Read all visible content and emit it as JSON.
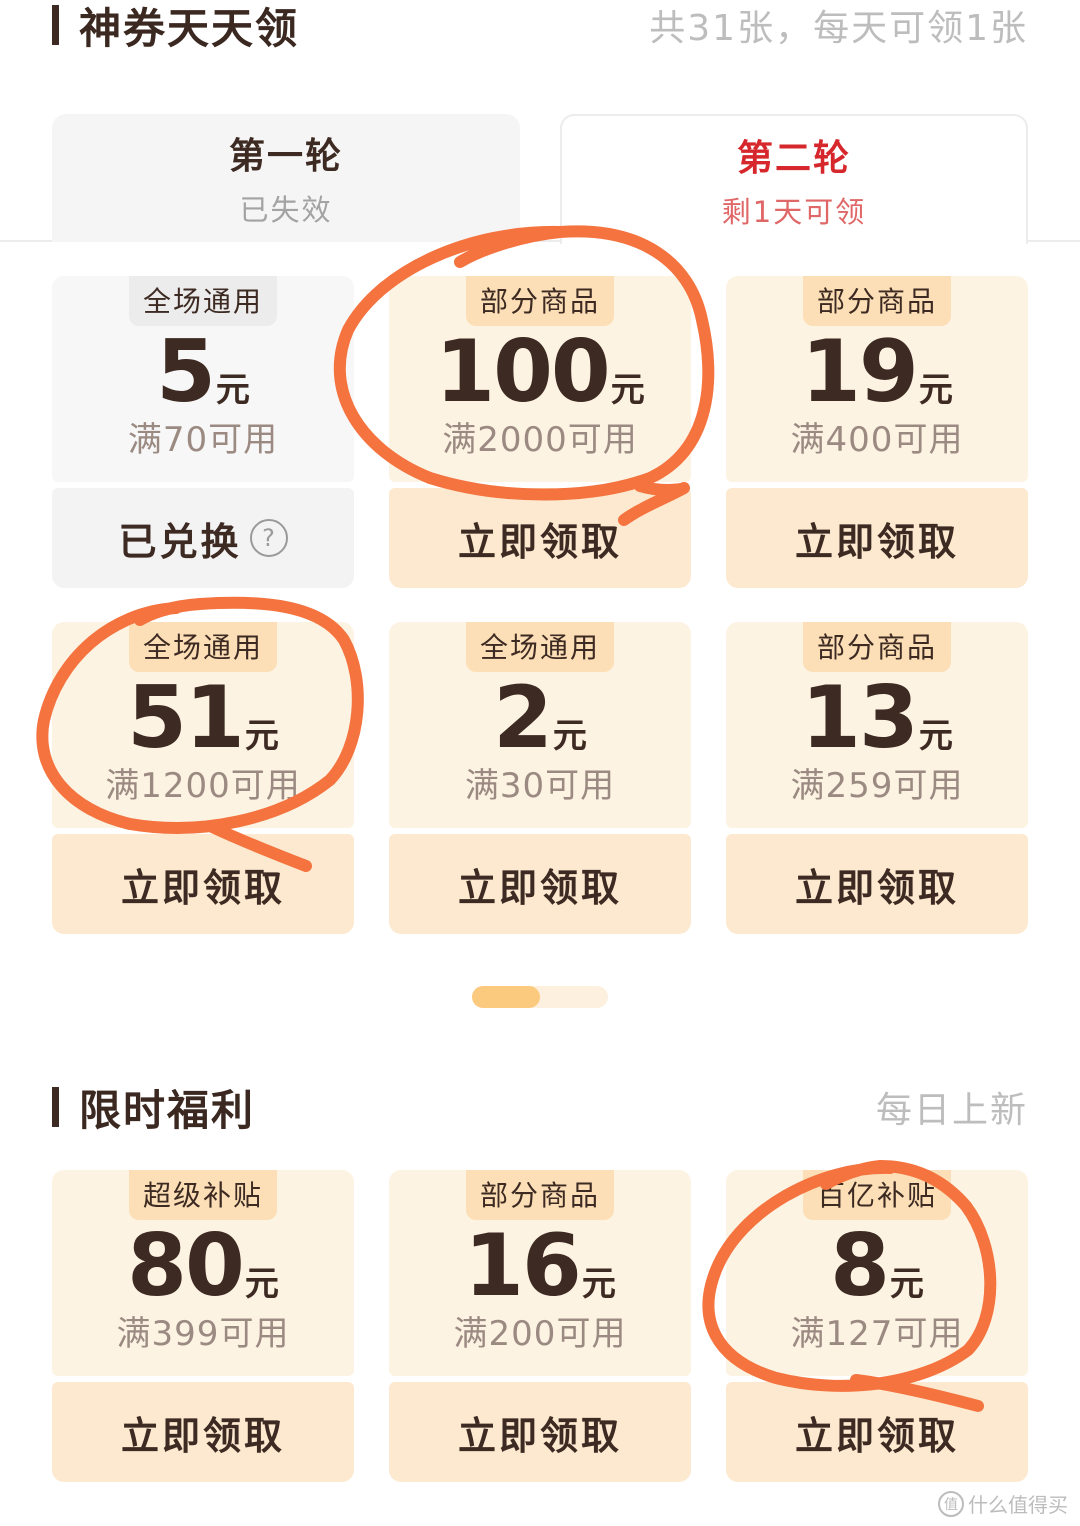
{
  "section1": {
    "title": "神券天天领",
    "subtitle": "共31张，每天可领1张"
  },
  "rounds": [
    {
      "name": "第一轮",
      "status": "已失效",
      "active": false
    },
    {
      "name": "第二轮",
      "status": "剩1天可领",
      "active": true
    }
  ],
  "coupons": [
    {
      "tag": "全场通用",
      "amount": "5",
      "unit": "元",
      "condition": "满70可用",
      "action": "已兑换",
      "used": true,
      "help_icon": "?"
    },
    {
      "tag": "部分商品",
      "amount": "100",
      "unit": "元",
      "condition": "满2000可用",
      "action": "立即领取"
    },
    {
      "tag": "部分商品",
      "amount": "19",
      "unit": "元",
      "condition": "满400可用",
      "action": "立即领取"
    },
    {
      "tag": "全场通用",
      "amount": "51",
      "unit": "元",
      "condition": "满1200可用",
      "action": "立即领取"
    },
    {
      "tag": "全场通用",
      "amount": "2",
      "unit": "元",
      "condition": "满30可用",
      "action": "立即领取"
    },
    {
      "tag": "部分商品",
      "amount": "13",
      "unit": "元",
      "condition": "满259可用",
      "action": "立即领取"
    }
  ],
  "pager": {
    "progress": 0.5
  },
  "section2": {
    "title": "限时福利",
    "subtitle": "每日上新"
  },
  "welfare": [
    {
      "tag": "超级补贴",
      "amount": "80",
      "unit": "元",
      "condition": "满399可用",
      "action": "立即领取"
    },
    {
      "tag": "部分商品",
      "amount": "16",
      "unit": "元",
      "condition": "满200可用",
      "action": "立即领取"
    },
    {
      "tag": "百亿补贴",
      "amount": "8",
      "unit": "元",
      "condition": "满127可用",
      "action": "立即领取"
    }
  ],
  "watermark": {
    "text": "什么值得买",
    "icon": "值"
  },
  "colors": {
    "accent_red": "#d6282c",
    "annotation": "#f4733f",
    "coupon_bg": "#fdf3e3",
    "button_bg": "#fde9cf"
  }
}
